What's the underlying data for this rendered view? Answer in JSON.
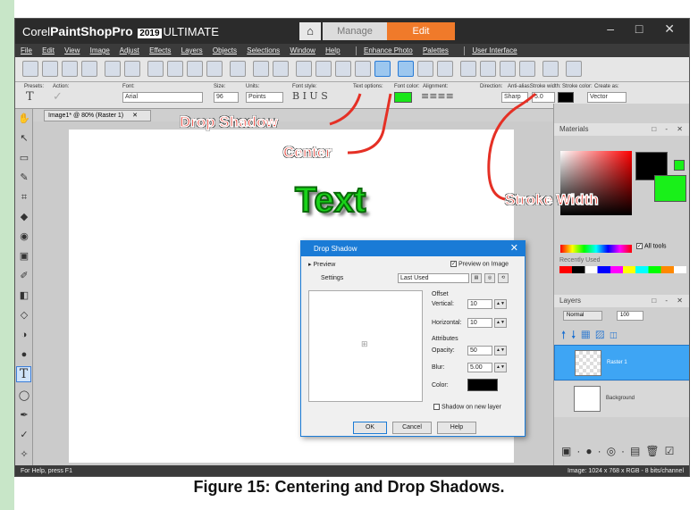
{
  "app": {
    "brand_prefix": "Corel",
    "brand_name": "PaintShop",
    "brand_pro": "Pro",
    "version": "2019",
    "edition": "ULTIMATE",
    "tab_manage": "Manage",
    "tab_edit": "Edit",
    "window_controls": "– □ ✕"
  },
  "menu": [
    "File",
    "Edit",
    "View",
    "Image",
    "Adjust",
    "Effects",
    "Layers",
    "Objects",
    "Selections",
    "Window",
    "Help"
  ],
  "menu_extra": [
    "Enhance Photo",
    "Palettes",
    "User Interface"
  ],
  "options": {
    "labels": {
      "presets": "Presets:",
      "action": "Action:",
      "font": "Font:",
      "size": "Size:",
      "units": "Units:",
      "font_style": "Font style:",
      "text_options": "Text options:",
      "font_color": "Font color:",
      "alignment": "Alignment:",
      "direction": "Direction:",
      "anti_alias": "Anti-alias:",
      "stroke_width": "Stroke width:",
      "stroke_color": "Stroke color:",
      "create_as": "Create as:"
    },
    "font": "Arial",
    "size": "96",
    "units": "Points",
    "anti_alias": "Sharp",
    "stroke_width": "5.0",
    "create_as": "Vector",
    "font_color": "#19e619",
    "stroke_color": "#000000"
  },
  "document_tab": "Image1* @ 80% (Raster 1)",
  "canvas_text": "Text",
  "status": {
    "left": "For Help, press F1",
    "right": "Image: 1024 x 768 x RGB - 8 bits/channel"
  },
  "materials": {
    "title": "Materials",
    "all_tools": "All tools",
    "recently_used": "Recently Used"
  },
  "layers": {
    "title": "Layers",
    "blend_mode": "Normal",
    "opacity": "100",
    "items": [
      "Raster 1",
      "Background"
    ]
  },
  "dialog": {
    "title": "Drop Shadow",
    "preview_toggle": "Preview",
    "preview_on_image": "Preview on Image",
    "settings_label": "Settings",
    "settings_value": "Last Used",
    "offset_label": "Offset",
    "vertical_label": "Vertical:",
    "vertical_value": "10",
    "horizontal_label": "Horizontal:",
    "horizontal_value": "10",
    "attributes_label": "Attributes",
    "opacity_label": "Opacity:",
    "opacity_value": "50",
    "blur_label": "Blur:",
    "blur_value": "5.00",
    "color_label": "Color:",
    "shadow_color": "#000000",
    "new_layer_label": "Shadow on new layer",
    "ok": "OK",
    "cancel": "Cancel",
    "help": "Help"
  },
  "callouts": {
    "drop_shadow": "Drop Shadow",
    "center": "Center",
    "stroke_width": "Stroke Width"
  },
  "caption": "Figure 15: Centering and Drop Shadows."
}
